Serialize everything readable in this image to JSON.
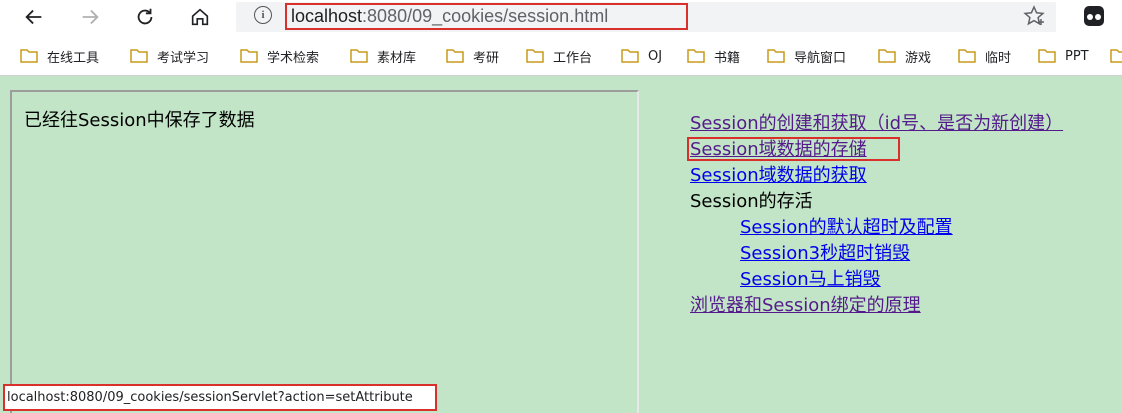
{
  "toolbar": {
    "url_host": "localhost",
    "url_path": ":8080/09_cookies/session.html"
  },
  "bookmarks": [
    {
      "label": "在线工具"
    },
    {
      "label": "考试学习"
    },
    {
      "label": "学术检索"
    },
    {
      "label": "素材库"
    },
    {
      "label": "考研"
    },
    {
      "label": "工作台"
    },
    {
      "label": "OJ"
    },
    {
      "label": "书籍"
    },
    {
      "label": "导航窗口"
    },
    {
      "label": "游戏"
    },
    {
      "label": "临时"
    },
    {
      "label": "PPT"
    }
  ],
  "frame": {
    "message": "已经往Session中保存了数据"
  },
  "menu": {
    "create": "Session的创建和获取（id号、是否为新创建）",
    "store": "Session域数据的存储",
    "get": "Session域数据的获取",
    "lifetime": "Session的存活",
    "default_timeout": "Session的默认超时及配置",
    "timeout3": "Session3秒超时销毁",
    "invalidate": "Session马上销毁",
    "binding": "浏览器和Session绑定的原理"
  },
  "status": {
    "url": "localhost:8080/09_cookies/sessionServlet?action=setAttribute"
  },
  "colors": {
    "page_bg": "#c1e5c6",
    "link": "#0000ee",
    "visited": "#551a8b",
    "highlight": "#d9302c"
  }
}
